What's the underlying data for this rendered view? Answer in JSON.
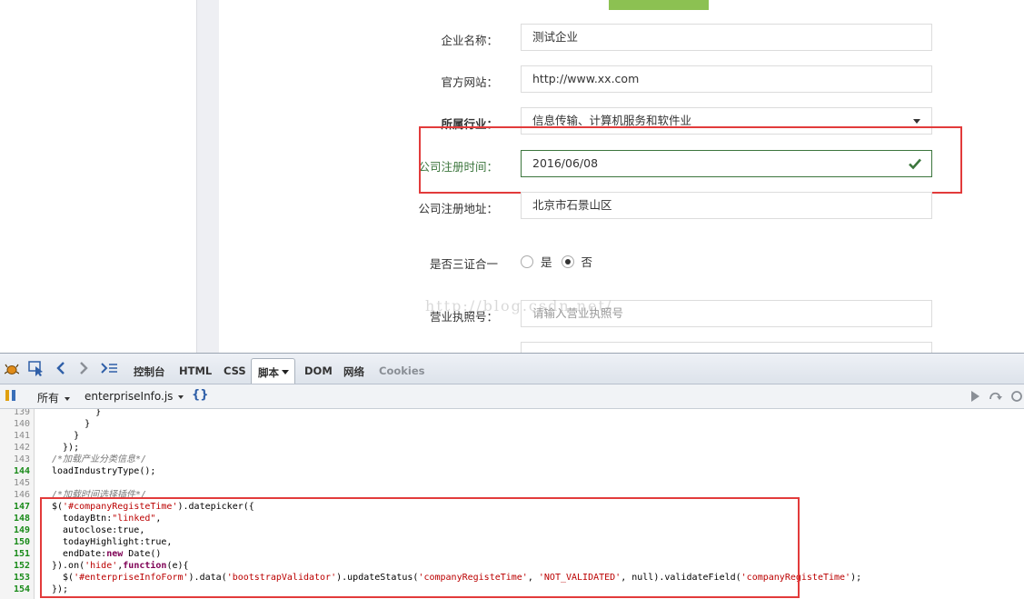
{
  "form": {
    "company_name": {
      "label": "企业名称：",
      "value": "测试企业"
    },
    "website": {
      "label": "官方网站：",
      "value": "http://www.xx.com"
    },
    "industry": {
      "label": "所属行业：",
      "value": "信息传输、计算机服务和软件业"
    },
    "register_time": {
      "label": "公司注册时间：",
      "value": "2016/06/08"
    },
    "register_address": {
      "label": "公司注册地址：",
      "value": "北京市石景山区"
    },
    "three_in_one": {
      "label": "是否三证合一",
      "options": [
        "是",
        "否"
      ],
      "selected": "否"
    },
    "license_no": {
      "label": "营业执照号：",
      "placeholder": "请输入营业执照号"
    }
  },
  "watermark": "http://blog.csdn.net/",
  "firebug": {
    "tabs": [
      "控制台",
      "HTML",
      "CSS",
      "脚本",
      "DOM",
      "网络",
      "Cookies"
    ],
    "active_tab": "脚本",
    "filter_label": "所有",
    "file_name": "enterpriseInfo.js",
    "pretty_print": "{}"
  },
  "code_lines": [
    {
      "ln": "139",
      "exec": false,
      "text": "        }"
    },
    {
      "ln": "140",
      "exec": false,
      "text": "      }"
    },
    {
      "ln": "141",
      "exec": false,
      "text": "    }"
    },
    {
      "ln": "142",
      "exec": false,
      "text": "  });"
    },
    {
      "ln": "143",
      "exec": false,
      "text": "/*加载产业分类信息*/"
    },
    {
      "ln": "144",
      "exec": true,
      "text": "loadIndustryType();"
    },
    {
      "ln": "145",
      "exec": false,
      "text": ""
    },
    {
      "ln": "146",
      "exec": false,
      "text": "/*加载时间选择插件*/"
    },
    {
      "ln": "147",
      "exec": true,
      "text": "$('#companyRegisteTime').datepicker({"
    },
    {
      "ln": "148",
      "exec": true,
      "text": "  todayBtn:\"linked\","
    },
    {
      "ln": "149",
      "exec": true,
      "text": "  autoclose:true,"
    },
    {
      "ln": "150",
      "exec": true,
      "text": "  todayHighlight:true,"
    },
    {
      "ln": "151",
      "exec": true,
      "text": "  endDate:new Date()"
    },
    {
      "ln": "152",
      "exec": true,
      "text": "}).on('hide',function(e){"
    },
    {
      "ln": "153",
      "exec": true,
      "text": "  $('#enterpriseInfoForm').data('bootstrapValidator').updateStatus('companyRegisteTime', 'NOT_VALIDATED', null).validateField('companyRegisteTime');"
    },
    {
      "ln": "154",
      "exec": true,
      "text": "});"
    }
  ],
  "colors": {
    "highlight_box": "#e23b3b",
    "success_green": "#3c763d",
    "button_green": "#8cc152"
  }
}
